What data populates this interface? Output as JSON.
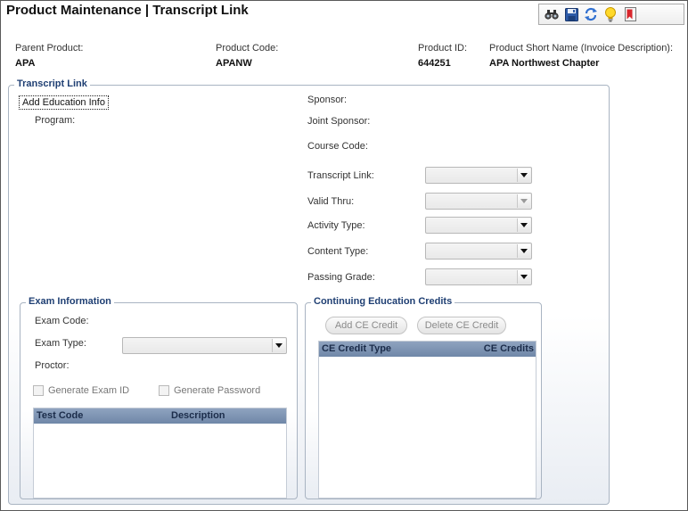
{
  "page": {
    "title": "Product Maintenance  |  Transcript Link"
  },
  "toolbar": {
    "icons": [
      "binoculars-icon",
      "save-icon",
      "refresh-icon",
      "lightbulb-icon",
      "bookmark-icon"
    ]
  },
  "header": {
    "parent_product_label": "Parent Product:",
    "parent_product_value": "APA",
    "product_code_label": "Product Code:",
    "product_code_value": "APANW",
    "product_id_label": "Product ID:",
    "product_id_value": "644251",
    "short_name_label": "Product Short Name (Invoice Description):",
    "short_name_value": "APA Northwest Chapter"
  },
  "transcript": {
    "legend": "Transcript Link",
    "add_education_label": "Add Education Info",
    "program_label": "Program:",
    "sponsor_label": "Sponsor:",
    "joint_sponsor_label": "Joint Sponsor:",
    "course_code_label": "Course Code:",
    "transcript_link_label": "Transcript Link:",
    "valid_thru_label": "Valid Thru:",
    "activity_type_label": "Activity Type:",
    "content_type_label": "Content Type:",
    "passing_grade_label": "Passing Grade:"
  },
  "exam": {
    "legend": "Exam Information",
    "exam_code_label": "Exam Code:",
    "exam_type_label": "Exam Type:",
    "proctor_label": "Proctor:",
    "generate_exam_id_label": "Generate Exam ID",
    "generate_password_label": "Generate Password",
    "columns": [
      "Test Code",
      "Description"
    ]
  },
  "ce": {
    "legend": "Continuing Education Credits",
    "add_label": "Add CE Credit",
    "delete_label": "Delete CE Credit",
    "columns": [
      "CE Credit Type",
      "CE Credits"
    ]
  },
  "colors": {
    "legend_text": "#1f3f73",
    "grid_header": "#7f95b4",
    "group_border": "#a9b4c2"
  }
}
